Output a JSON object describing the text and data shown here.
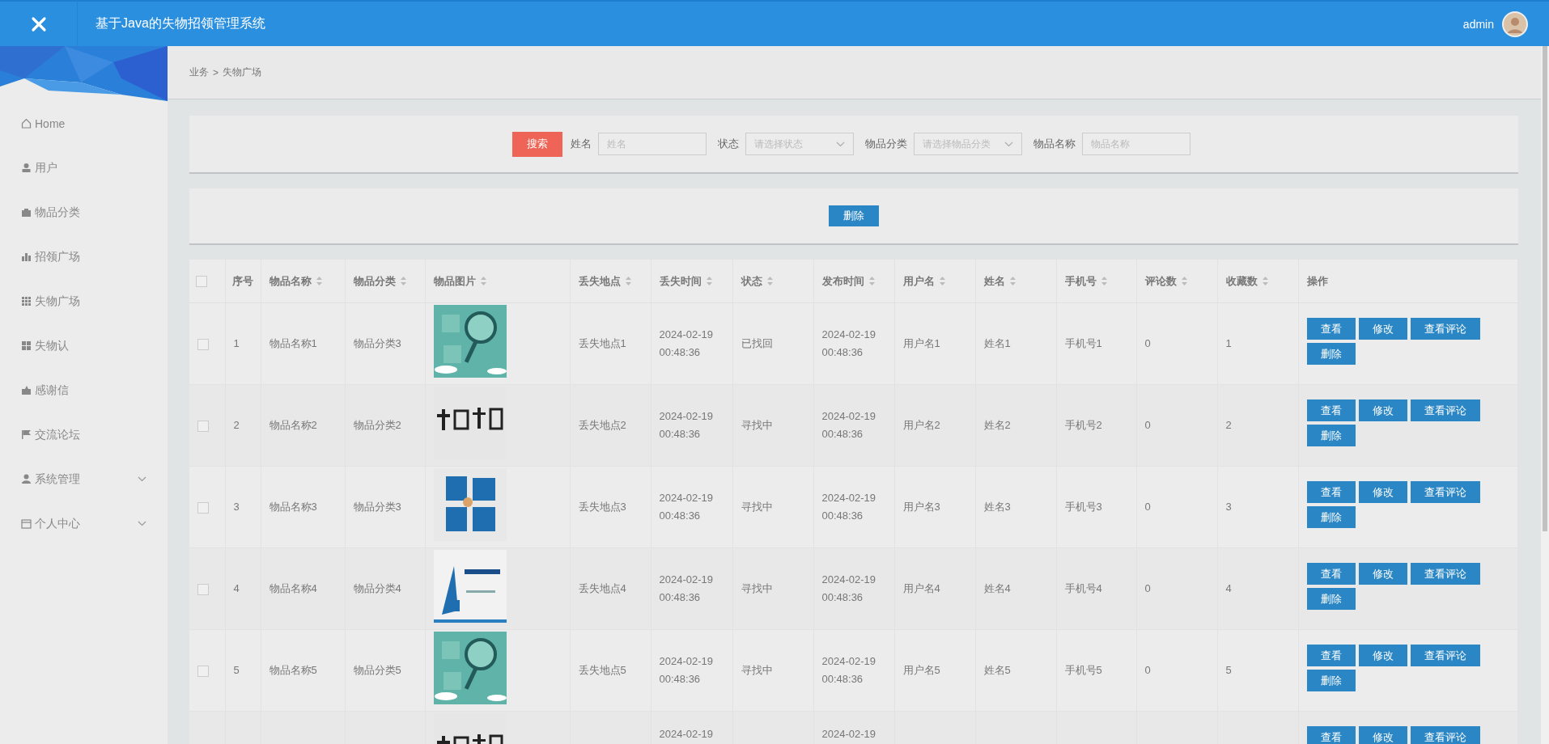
{
  "header": {
    "title": "基于Java的失物招领管理系统",
    "user": "admin"
  },
  "sidebar": {
    "items": [
      {
        "label": "Home",
        "has_submenu": false
      },
      {
        "label": "用户",
        "has_submenu": false
      },
      {
        "label": "物品分类",
        "has_submenu": false
      },
      {
        "label": "招领广场",
        "has_submenu": false
      },
      {
        "label": "失物广场",
        "has_submenu": false
      },
      {
        "label": "失物认",
        "has_submenu": false
      },
      {
        "label": "感谢信",
        "has_submenu": false
      },
      {
        "label": "交流论坛",
        "has_submenu": false
      },
      {
        "label": "系统管理",
        "has_submenu": true
      },
      {
        "label": "个人中心",
        "has_submenu": true
      }
    ]
  },
  "breadcrumb": {
    "items": [
      "业务",
      "失物广场"
    ],
    "separator": ">"
  },
  "search": {
    "button": "搜索",
    "fields": [
      {
        "label": "姓名",
        "placeholder": "姓名",
        "kind": "input"
      },
      {
        "label": "状态",
        "placeholder": "请选择状态",
        "kind": "select"
      },
      {
        "label": "物品分类",
        "placeholder": "请选择物品分类",
        "kind": "select"
      },
      {
        "label": "物品名称",
        "placeholder": "物品名称",
        "kind": "input"
      }
    ]
  },
  "toolbar": {
    "delete_button": "删除"
  },
  "table": {
    "header_checked": false,
    "columns": [
      {
        "label": "序号",
        "sortable": false
      },
      {
        "label": "物品名称",
        "sortable": true
      },
      {
        "label": "物品分类",
        "sortable": true
      },
      {
        "label": "物品图片",
        "sortable": true
      },
      {
        "label": "丢失地点",
        "sortable": true
      },
      {
        "label": "丢失时间",
        "sortable": true
      },
      {
        "label": "状态",
        "sortable": true
      },
      {
        "label": "发布时间",
        "sortable": true
      },
      {
        "label": "用户名",
        "sortable": true
      },
      {
        "label": "姓名",
        "sortable": true
      },
      {
        "label": "手机号",
        "sortable": true
      },
      {
        "label": "评论数",
        "sortable": true
      },
      {
        "label": "收藏数",
        "sortable": true
      },
      {
        "label": "操作",
        "sortable": false
      }
    ],
    "rows": [
      {
        "checked": false,
        "cells": [
          "1",
          "物品名称1",
          "物品分类3",
          null,
          "丢失地点1",
          "2024-02-19 00:48:36",
          "已找回",
          "2024-02-19 00:48:36",
          "用户名1",
          "姓名1",
          "手机号1",
          "0",
          "1"
        ],
        "actions": [
          "查看",
          "修改",
          "查看评论",
          "删除"
        ]
      },
      {
        "checked": false,
        "cells": [
          "2",
          "物品名称2",
          "物品分类2",
          null,
          "丢失地点2",
          "2024-02-19 00:48:36",
          "寻找中",
          "2024-02-19 00:48:36",
          "用户名2",
          "姓名2",
          "手机号2",
          "0",
          "2"
        ],
        "actions": [
          "查看",
          "修改",
          "查看评论",
          "删除"
        ]
      },
      {
        "checked": false,
        "cells": [
          "3",
          "物品名称3",
          "物品分类3",
          null,
          "丢失地点3",
          "2024-02-19 00:48:36",
          "寻找中",
          "2024-02-19 00:48:36",
          "用户名3",
          "姓名3",
          "手机号3",
          "0",
          "3"
        ],
        "actions": [
          "查看",
          "修改",
          "查看评论",
          "删除"
        ]
      },
      {
        "checked": false,
        "cells": [
          "4",
          "物品名称4",
          "物品分类4",
          null,
          "丢失地点4",
          "2024-02-19 00:48:36",
          "寻找中",
          "2024-02-19 00:48:36",
          "用户名4",
          "姓名4",
          "手机号4",
          "0",
          "4"
        ],
        "actions": [
          "查看",
          "修改",
          "查看评论",
          "删除"
        ]
      },
      {
        "checked": false,
        "cells": [
          "5",
          "物品名称5",
          "物品分类5",
          null,
          "丢失地点5",
          "2024-02-19 00:48:36",
          "寻找中",
          "2024-02-19 00:48:36",
          "用户名5",
          "姓名5",
          "手机号5",
          "0",
          "5"
        ],
        "actions": [
          "查看",
          "修改",
          "查看评论",
          "删除"
        ]
      },
      {
        "cells": [
          null,
          null,
          null,
          null,
          null,
          "2024-02-19",
          null,
          "2024-02-19",
          null,
          null,
          null,
          null,
          null
        ],
        "actions": [
          "查看",
          "修改",
          "查看评论"
        ]
      }
    ]
  }
}
